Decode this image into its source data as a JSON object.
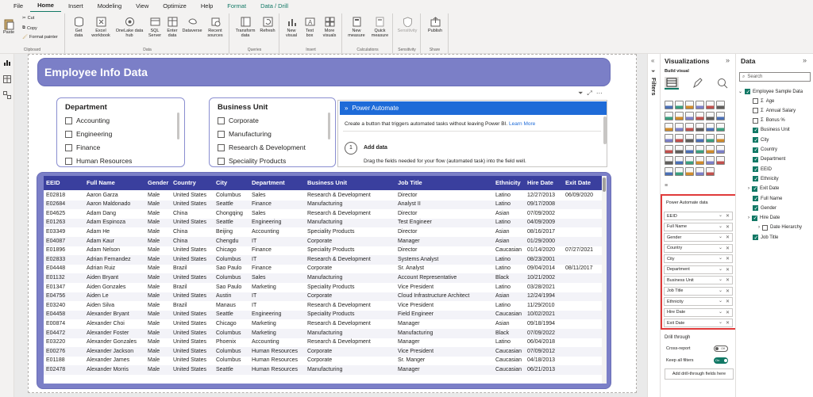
{
  "menu": [
    "File",
    "Home",
    "Insert",
    "Modeling",
    "View",
    "Optimize",
    "Help",
    "Format",
    "Data / Drill"
  ],
  "ribbon": {
    "clipboard": {
      "paste": "Paste",
      "cut": "Cut",
      "copy": "Copy",
      "format_painter": "Format painter",
      "group": "Clipboard"
    },
    "data": {
      "get_data": "Get data",
      "excel": "Excel workbook",
      "onelake": "OneLake data hub",
      "sql": "SQL Server",
      "enter": "Enter data",
      "dataverse": "Dataverse",
      "recent": "Recent sources",
      "group": "Data"
    },
    "queries": {
      "transform": "Transform data",
      "refresh": "Refresh",
      "group": "Queries"
    },
    "insert": {
      "new_visual": "New visual",
      "text_box": "Text box",
      "more_visuals": "More visuals",
      "group": "Insert"
    },
    "calculations": {
      "new_measure": "New measure",
      "quick_measure": "Quick measure",
      "group": "Calculations"
    },
    "sensitivity": {
      "label": "Sensitivity",
      "group": "Sensitivity"
    },
    "share": {
      "publish": "Publish",
      "group": "Share"
    }
  },
  "report": {
    "title": "Employee Info Data",
    "dept_slicer": {
      "title": "Department",
      "items": [
        "Accounting",
        "Engineering",
        "Finance",
        "Human Resources"
      ]
    },
    "bu_slicer": {
      "title": "Business Unit",
      "items": [
        "Corporate",
        "Manufacturing",
        "Research & Development",
        "Speciality Products"
      ]
    },
    "power_automate": {
      "header": "Power Automate",
      "desc": "Create a button that triggers automated tasks without leaving Power BI.",
      "link": "Learn More",
      "step_num": "1",
      "step_title": "Add data",
      "step_desc": "Drag the fields needed for your flow (automated task) into the field well."
    }
  },
  "table": {
    "columns": [
      "EEID",
      "Full Name",
      "Gender",
      "Country",
      "City",
      "Department",
      "Business Unit",
      "Job Title",
      "Ethnicity",
      "Hire Date",
      "Exit Date"
    ],
    "rows": [
      [
        "E02818",
        "Aaron Garza",
        "Male",
        "United States",
        "Columbus",
        "Sales",
        "Research & Development",
        "Director",
        "Latino",
        "12/27/2013",
        "06/09/2020"
      ],
      [
        "E02684",
        "Aaron Maldonado",
        "Male",
        "United States",
        "Seattle",
        "Finance",
        "Manufacturing",
        "Analyst II",
        "Latino",
        "09/17/2008",
        ""
      ],
      [
        "E04625",
        "Adam Dang",
        "Male",
        "China",
        "Chongqing",
        "Sales",
        "Research & Development",
        "Director",
        "Asian",
        "07/09/2002",
        ""
      ],
      [
        "E01263",
        "Adam Espinoza",
        "Male",
        "United States",
        "Seattle",
        "Engineering",
        "Manufacturing",
        "Test Engineer",
        "Latino",
        "04/09/2009",
        ""
      ],
      [
        "E03349",
        "Adam He",
        "Male",
        "China",
        "Beijing",
        "Accounting",
        "Speciality Products",
        "Director",
        "Asian",
        "08/16/2017",
        ""
      ],
      [
        "E04087",
        "Adam Kaur",
        "Male",
        "China",
        "Chengdu",
        "IT",
        "Corporate",
        "Manager",
        "Asian",
        "01/29/2000",
        ""
      ],
      [
        "E01896",
        "Adam Nelson",
        "Male",
        "United States",
        "Chicago",
        "Finance",
        "Speciality Products",
        "Director",
        "Caucasian",
        "01/14/2020",
        "07/27/2021"
      ],
      [
        "E02833",
        "Adrian Fernandez",
        "Male",
        "United States",
        "Columbus",
        "IT",
        "Research & Development",
        "Systems Analyst",
        "Latino",
        "08/23/2001",
        ""
      ],
      [
        "E04448",
        "Adrian Ruiz",
        "Male",
        "Brazil",
        "Sao Paulo",
        "Finance",
        "Corporate",
        "Sr. Analyst",
        "Latino",
        "09/04/2014",
        "08/11/2017"
      ],
      [
        "E01132",
        "Aiden Bryant",
        "Male",
        "United States",
        "Columbus",
        "Sales",
        "Manufacturing",
        "Account Representative",
        "Black",
        "10/21/2002",
        ""
      ],
      [
        "E01347",
        "Aiden Gonzales",
        "Male",
        "Brazil",
        "Sao Paulo",
        "Marketing",
        "Speciality Products",
        "Vice President",
        "Latino",
        "03/28/2021",
        ""
      ],
      [
        "E04756",
        "Aiden Le",
        "Male",
        "United States",
        "Austin",
        "IT",
        "Corporate",
        "Cloud Infrastructure Architect",
        "Asian",
        "12/24/1994",
        ""
      ],
      [
        "E03240",
        "Aiden Silva",
        "Male",
        "Brazil",
        "Manaus",
        "IT",
        "Research & Development",
        "Vice President",
        "Latino",
        "11/29/2010",
        ""
      ],
      [
        "E04458",
        "Alexander Bryant",
        "Male",
        "United States",
        "Seattle",
        "Engineering",
        "Speciality Products",
        "Field Engineer",
        "Caucasian",
        "10/02/2021",
        ""
      ],
      [
        "E00874",
        "Alexander Choi",
        "Male",
        "United States",
        "Chicago",
        "Marketing",
        "Research & Development",
        "Manager",
        "Asian",
        "09/18/1994",
        ""
      ],
      [
        "E04472",
        "Alexander Foster",
        "Male",
        "United States",
        "Columbus",
        "Marketing",
        "Manufacturing",
        "Manufacturing",
        "Black",
        "07/09/2022",
        ""
      ],
      [
        "E03220",
        "Alexander Gonzales",
        "Male",
        "United States",
        "Phoenix",
        "Accounting",
        "Research & Development",
        "Manager",
        "Latino",
        "06/04/2018",
        ""
      ],
      [
        "E00276",
        "Alexander Jackson",
        "Male",
        "United States",
        "Columbus",
        "Human Resources",
        "Corporate",
        "Vice President",
        "Caucasian",
        "07/09/2012",
        ""
      ],
      [
        "E01188",
        "Alexander James",
        "Male",
        "United States",
        "Columbus",
        "Human Resources",
        "Corporate",
        "Sr. Manger",
        "Caucasian",
        "04/18/2013",
        ""
      ],
      [
        "E02478",
        "Alexander Morris",
        "Male",
        "United States",
        "Seattle",
        "Human Resources",
        "Manufacturing",
        "Manager",
        "Caucasian",
        "06/21/2013",
        ""
      ]
    ]
  },
  "filters_label": "Filters",
  "viz_pane": {
    "title": "Visualizations",
    "build": "Build visual",
    "pa_data": "Power Automate data",
    "wells": [
      "EEID",
      "Full Name",
      "Gender",
      "Country",
      "City",
      "Department",
      "Business Unit",
      "Job Title",
      "Ethnicity",
      "Hire Date",
      "Exit Date"
    ],
    "drill_through": "Drill through",
    "cross_report": "Cross-report",
    "cross_report_state": "Off",
    "keep_filters": "Keep all filters",
    "keep_filters_state": "On",
    "add_drill": "Add drill-through fields here"
  },
  "data_pane": {
    "title": "Data",
    "search_placeholder": "Search",
    "table": "Employee Sample Data",
    "fields": [
      {
        "name": "Age",
        "checked": false,
        "sigma": true
      },
      {
        "name": "Annual Salary",
        "checked": false,
        "sigma": true
      },
      {
        "name": "Bonus %",
        "checked": false,
        "sigma": true
      },
      {
        "name": "Business Unit",
        "checked": true,
        "sigma": false
      },
      {
        "name": "City",
        "checked": true,
        "sigma": false
      },
      {
        "name": "Country",
        "checked": true,
        "sigma": false
      },
      {
        "name": "Department",
        "checked": true,
        "sigma": false
      },
      {
        "name": "EEID",
        "checked": true,
        "sigma": false
      },
      {
        "name": "Ethnicity",
        "checked": true,
        "sigma": false
      },
      {
        "name": "Exit Date",
        "checked": true,
        "sigma": false
      },
      {
        "name": "Full Name",
        "checked": true,
        "sigma": false
      },
      {
        "name": "Gender",
        "checked": true,
        "sigma": false
      },
      {
        "name": "Hire Date",
        "checked": true,
        "sigma": false
      },
      {
        "name": "Date Hierarchy",
        "checked": false,
        "sigma": false
      },
      {
        "name": "Job Title",
        "checked": true,
        "sigma": false
      }
    ]
  },
  "colors": {
    "accent": "#117865",
    "banner": "#7b7fc7",
    "header": "#3a3f9e",
    "pa_blue": "#1e6bd8",
    "highlight": "#e03a3a"
  }
}
